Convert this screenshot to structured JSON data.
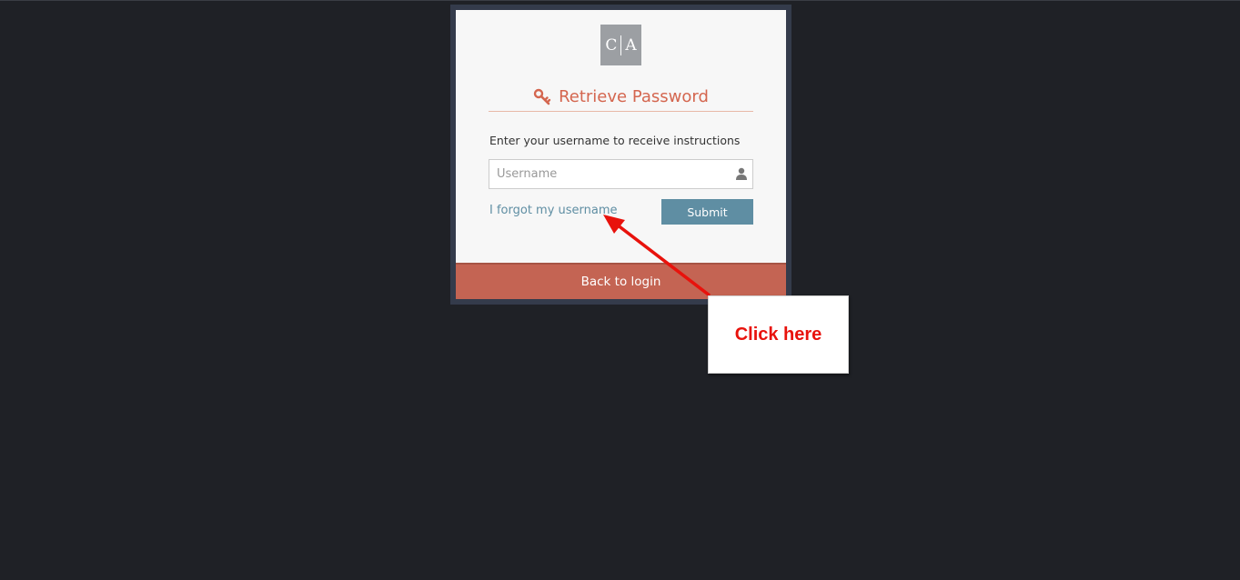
{
  "logo": {
    "left_letter": "C",
    "right_letter": "A"
  },
  "header": {
    "title": "Retrieve Password",
    "icon": "key-icon"
  },
  "form": {
    "instructions": "Enter your username to receive instructions",
    "username_placeholder": "Username",
    "username_value": "",
    "username_icon": "user-icon",
    "forgot_link": "I forgot my username",
    "submit_label": "Submit"
  },
  "footer": {
    "back_label": "Back to login"
  },
  "annotation": {
    "callout_text": "Click here"
  },
  "colors": {
    "background": "#1f2126",
    "frame": "#343b4b",
    "card": "#f7f7f7",
    "accent_title": "#d4664f",
    "link": "#5f8ea3",
    "submit": "#5f8ea3",
    "back_bar": "#c46453",
    "callout_text": "#e8120c"
  }
}
